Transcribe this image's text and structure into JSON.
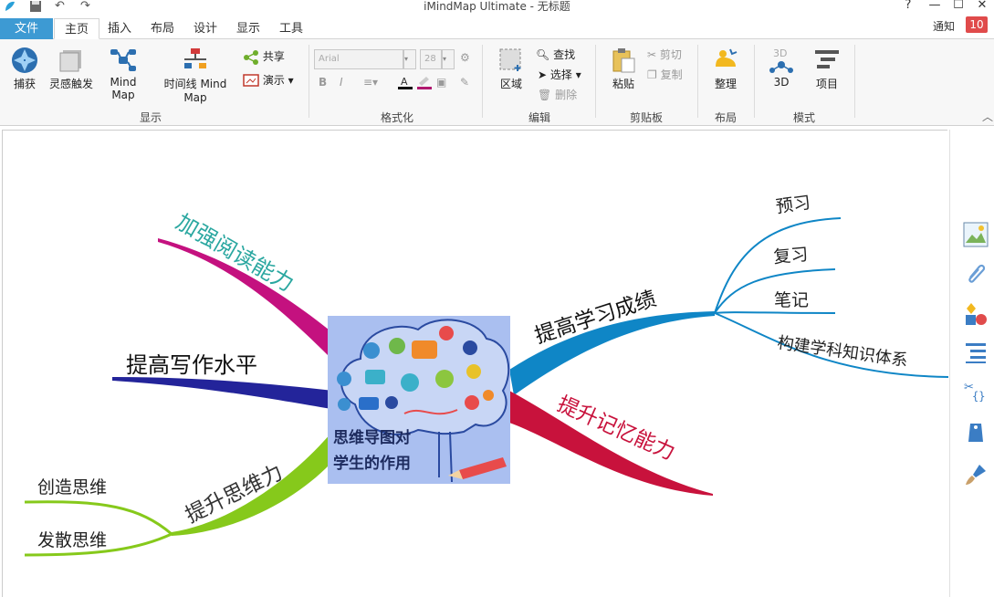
{
  "window": {
    "title": "iMindMap Ultimate - 无标题",
    "help": "?",
    "minimize": "—",
    "maximize": "☐",
    "close": "✕"
  },
  "tabs": [
    {
      "label": "文件"
    },
    {
      "label": "主页"
    },
    {
      "label": "插入"
    },
    {
      "label": "布局"
    },
    {
      "label": "设计"
    },
    {
      "label": "显示"
    },
    {
      "label": "工具"
    }
  ],
  "notifications": {
    "label": "通知",
    "count": "10"
  },
  "ribbon": {
    "display": {
      "group": "显示",
      "capture": "捕获",
      "inspiration": "灵感触发",
      "mindmap": "Mind Map",
      "timeline": "时间线 Mind Map",
      "share": "共享",
      "present": "演示"
    },
    "format": {
      "group": "格式化",
      "font": "Arial",
      "size": "28",
      "bold": "B",
      "italic": "I"
    },
    "edit": {
      "group": "编辑",
      "area": "区域",
      "find": "查找",
      "select": "选择",
      "delete": "删除"
    },
    "clipboard": {
      "group": "剪贴板",
      "paste": "粘贴",
      "cut": "剪切",
      "copy": "复制"
    },
    "layout": {
      "group": "布局",
      "arrange": "整理"
    },
    "mode": {
      "group": "模式",
      "three_d": "3D",
      "project": "项目",
      "three_d_icon_text": "3D"
    }
  },
  "mindmap": {
    "central": {
      "line1": "思维导图对",
      "line2": "学生的作用"
    },
    "branches": {
      "reading": "加强阅读能力",
      "writing": "提高写作水平",
      "thinking": "提升思维力",
      "thinking_sub": [
        "创造思维",
        "发散思维"
      ],
      "grades": "提高学习成绩",
      "grades_sub": [
        "预习",
        "复习",
        "笔记",
        "构建学科知识体系"
      ],
      "memory": "提升记忆能力"
    },
    "colors": {
      "reading": "#c4117f",
      "writing": "#23249a",
      "thinking": "#86c91b",
      "grades": "#0f86c6",
      "memory": "#c8123c"
    }
  },
  "side_panel": [
    "image-icon",
    "attachment-icon",
    "shapes-icon",
    "list-icon",
    "code-icon",
    "tag-icon",
    "brush-icon"
  ]
}
